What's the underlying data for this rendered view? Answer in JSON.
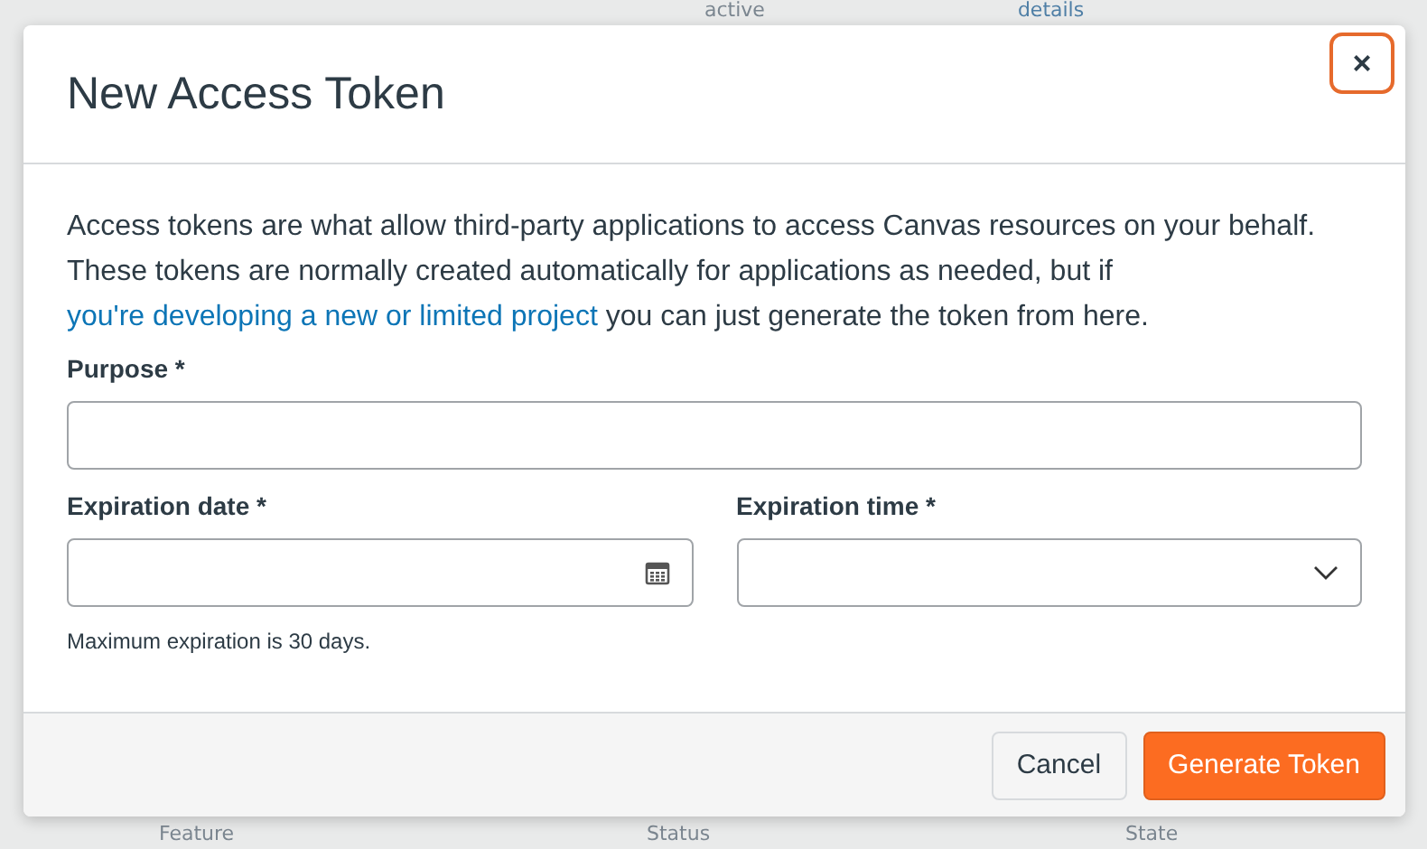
{
  "background": {
    "top_row": [
      "active",
      "details"
    ],
    "columns": [
      "Feature",
      "Status",
      "State"
    ]
  },
  "dialog": {
    "title": "New Access Token",
    "close_label": "×",
    "intro": "Access tokens are what allow third-party applications to access Canvas resources on your behalf. These tokens are normally created automatically for applications as needed, but if ",
    "intro_link": "you're developing a new or limited project",
    "intro_end": " you can just generate the token from here.",
    "purpose": {
      "label": "Purpose *"
    },
    "expiration_date": {
      "label": "Expiration date *"
    },
    "expiration_time": {
      "label": "Expiration time *"
    },
    "hint": "Maximum expiration is 30 days.",
    "buttons": [
      {
        "label": "Cancel",
        "kind": "secondary"
      },
      {
        "label": "Generate Token",
        "kind": "primary"
      }
    ]
  }
}
